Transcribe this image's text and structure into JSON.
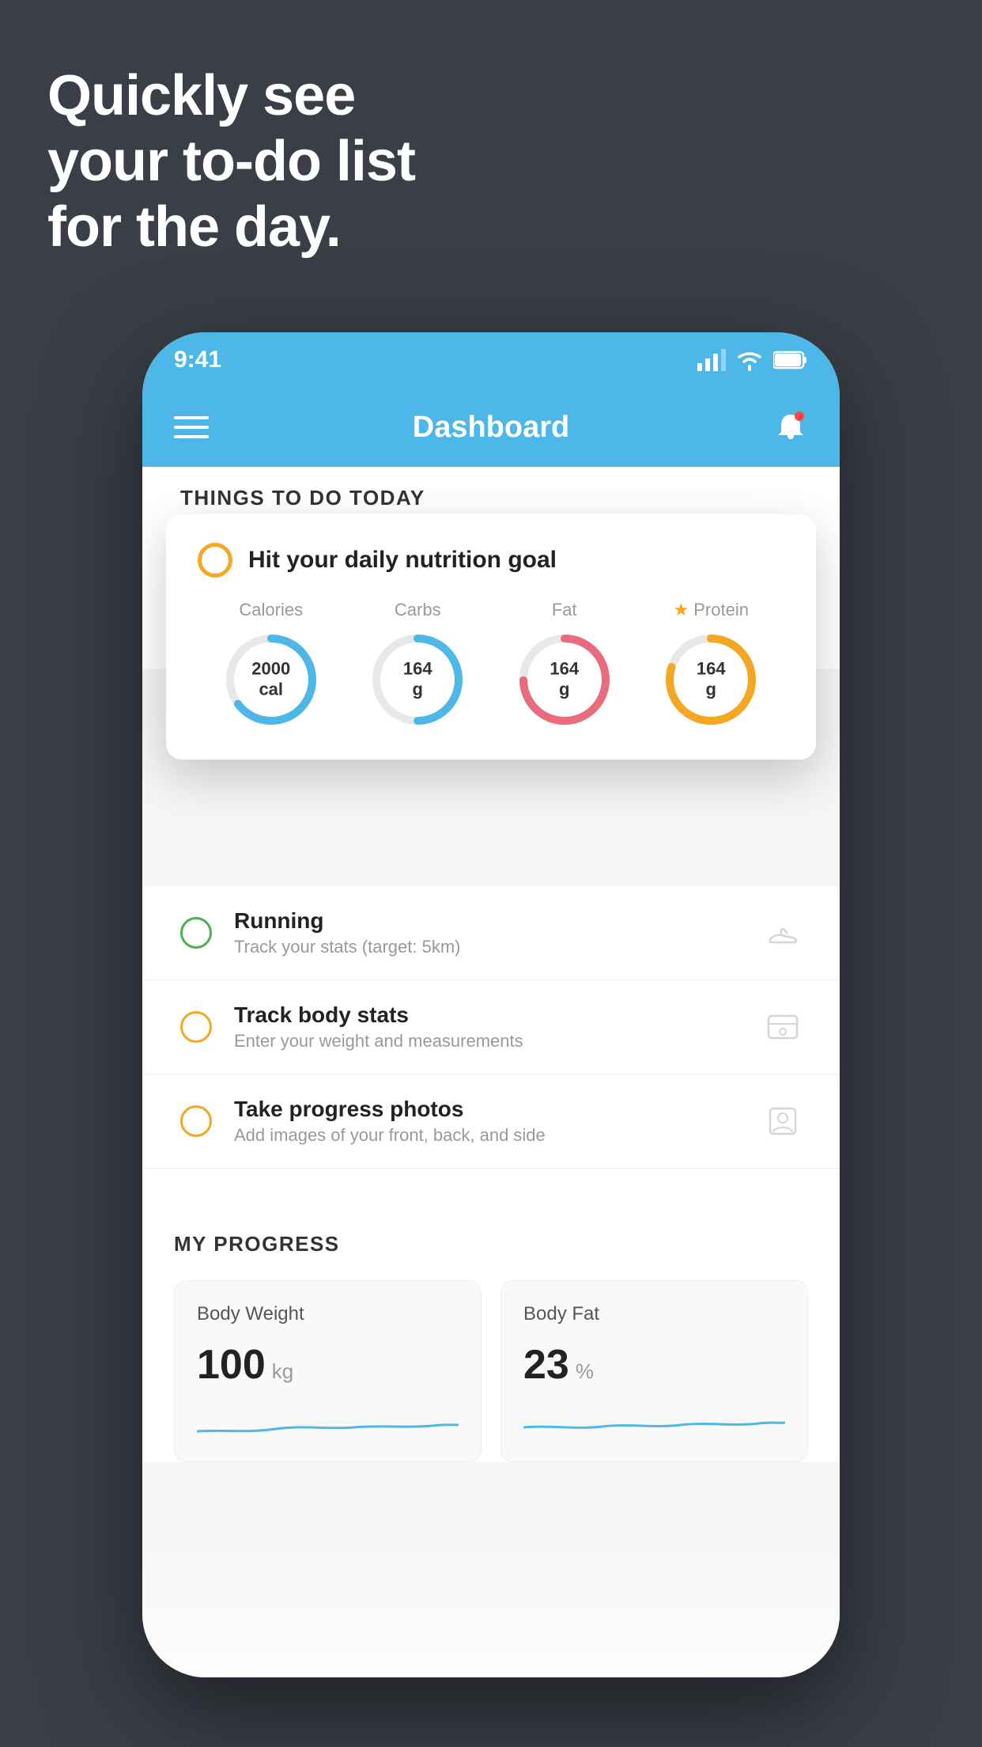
{
  "background_color": "#3a3f47",
  "hero": {
    "line1": "Quickly see",
    "line2": "your to-do list",
    "line3": "for the day."
  },
  "status_bar": {
    "time": "9:41",
    "signal": "▐▐▐▌",
    "wifi": "wifi",
    "battery": "battery"
  },
  "nav": {
    "title": "Dashboard"
  },
  "things_section": {
    "label": "THINGS TO DO TODAY"
  },
  "nutrition_card": {
    "check_color": "#f5a623",
    "title": "Hit your daily nutrition goal",
    "stats": [
      {
        "label": "Calories",
        "value": "2000",
        "unit": "cal",
        "color": "#4db8e8",
        "pct": 65
      },
      {
        "label": "Carbs",
        "value": "164",
        "unit": "g",
        "color": "#4db8e8",
        "pct": 50
      },
      {
        "label": "Fat",
        "value": "164",
        "unit": "g",
        "color": "#e96b7e",
        "pct": 75
      },
      {
        "label": "Protein",
        "value": "164",
        "unit": "g",
        "color": "#f5a623",
        "pct": 80,
        "starred": true
      }
    ]
  },
  "todo_items": [
    {
      "id": "running",
      "name": "Running",
      "desc": "Track your stats (target: 5km)",
      "circle_color": "green",
      "icon": "shoe"
    },
    {
      "id": "body-stats",
      "name": "Track body stats",
      "desc": "Enter your weight and measurements",
      "circle_color": "yellow",
      "icon": "scale"
    },
    {
      "id": "progress-photos",
      "name": "Take progress photos",
      "desc": "Add images of your front, back, and side",
      "circle_color": "yellow",
      "icon": "person"
    }
  ],
  "progress": {
    "section_label": "MY PROGRESS",
    "cards": [
      {
        "id": "weight",
        "title": "Body Weight",
        "value": "100",
        "unit": "kg"
      },
      {
        "id": "fat",
        "title": "Body Fat",
        "value": "23",
        "unit": "%"
      }
    ]
  }
}
